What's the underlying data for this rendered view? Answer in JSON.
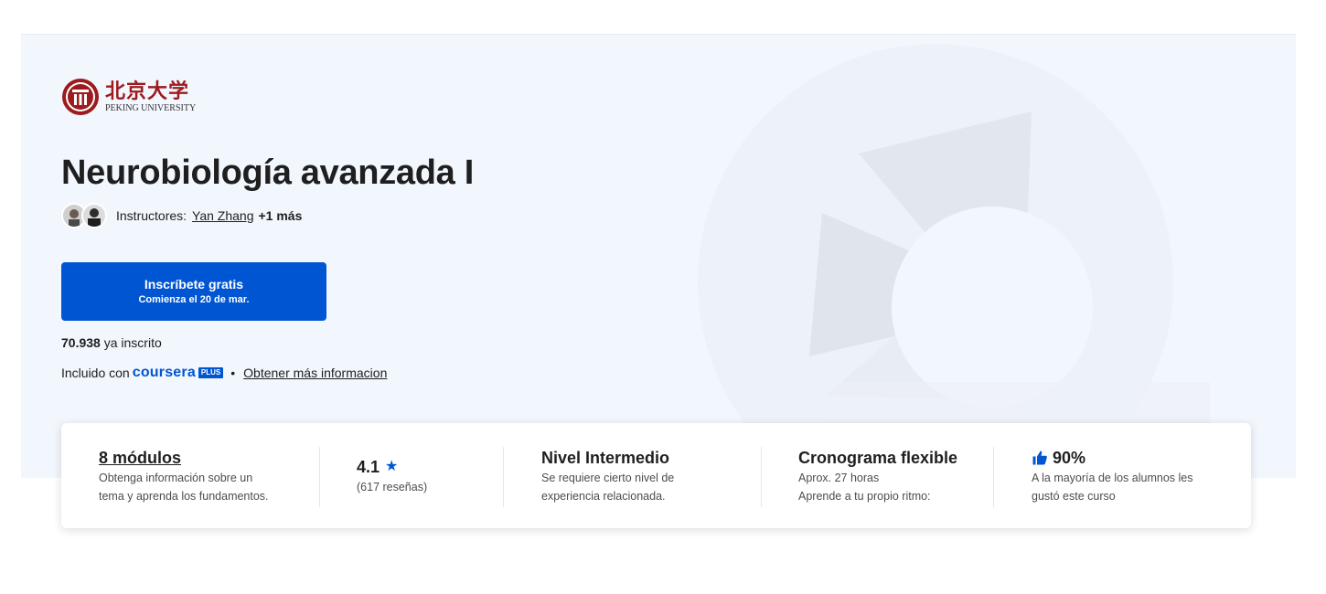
{
  "university": {
    "name_cn": "北京大学",
    "name_en": "PEKING UNIVERSITY"
  },
  "course": {
    "title": "Neurobiología avanzada I"
  },
  "instructors": {
    "label": "Instructores:",
    "primary": "Yan Zhang",
    "more": "+1 más"
  },
  "enroll": {
    "label": "Inscríbete gratis",
    "sub_label": "Comienza el 20 de mar."
  },
  "enrolled": {
    "count": "70.938",
    "suffix": "ya inscrito"
  },
  "included": {
    "prefix": "Incluido con",
    "brand": "coursera",
    "plus": "PLUS",
    "separator": "•",
    "more_info": "Obtener más informacion"
  },
  "stats": {
    "modules": {
      "title": "8 módulos",
      "desc_line1": "Obtenga información sobre un",
      "desc_line2": "tema y aprenda los fundamentos."
    },
    "rating": {
      "value": "4.1",
      "reviews": "(617 reseñas)"
    },
    "level": {
      "title": "Nivel Intermedio",
      "desc_line1": "Se requiere cierto nivel de",
      "desc_line2": "experiencia relacionada."
    },
    "schedule": {
      "title": "Cronograma flexible",
      "desc_line1": "Aprox. 27 horas",
      "desc_line2": "Aprende a tu propio ritmo:"
    },
    "approval": {
      "value": "90%",
      "desc_line1": "A la mayoría de los alumnos les",
      "desc_line2": "gustó este curso"
    }
  },
  "colors": {
    "primary": "#0056d2",
    "hero_bg": "#f2f6fd",
    "seal": "#9b1b1e"
  },
  "icons": [
    "pku-seal-icon",
    "star-icon",
    "thumbs-up-icon"
  ]
}
